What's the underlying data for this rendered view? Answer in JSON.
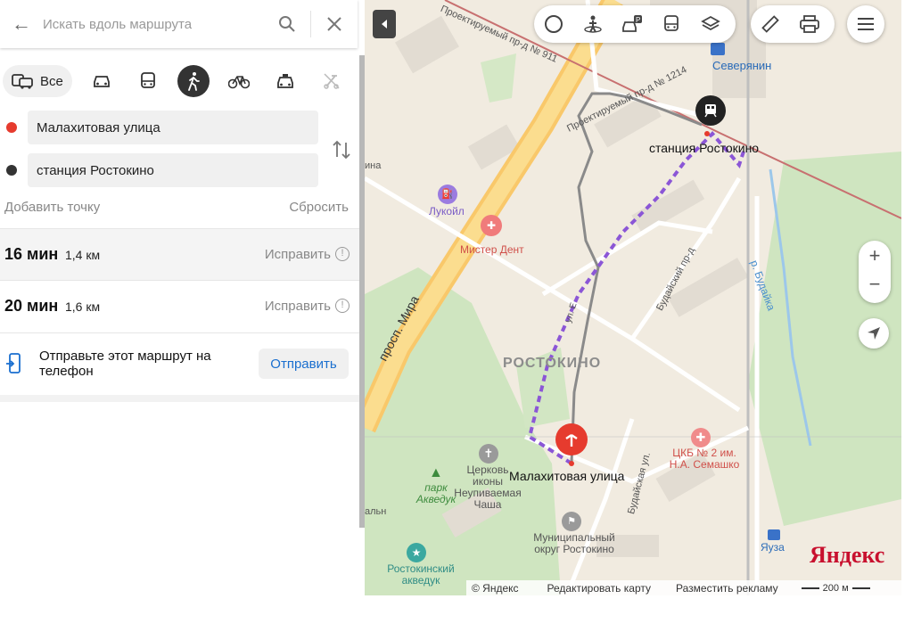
{
  "search": {
    "placeholder": "Искать вдоль маршрута"
  },
  "modes": {
    "all_label": "Все"
  },
  "points": {
    "from": "Малахитовая улица",
    "to": "станция Ростокино"
  },
  "actions": {
    "add_point": "Добавить точку",
    "reset": "Сбросить"
  },
  "routes": [
    {
      "time": "16 мин",
      "distance": "1,4 км",
      "fix": "Исправить"
    },
    {
      "time": "20 мин",
      "distance": "1,6 км",
      "fix": "Исправить"
    }
  ],
  "send": {
    "text": "Отправьте этот маршрут на телефон",
    "button": "Отправить"
  },
  "map": {
    "labels": {
      "station": "станция Ростокино",
      "street_start": "Малахитовая улица",
      "district": "РОСТОКИНО",
      "severyanin": "Северянин",
      "lukoil": "Лукойл",
      "mister_dent": "Мистер Дент",
      "prospekt": "просп. Мира",
      "proezd_911": "Проектируемый пр-д № 911",
      "proezd_1214": "Проектируемый пр-д № 1214",
      "budaysky_proezd": "Будайский пр-д",
      "budayskaya_ul": "Будайская ул.",
      "river": "р. Будайка",
      "church": "Церковь иконы Неупиваемая Чаша",
      "park": "парк Акведук",
      "municipal": "Муниципальный округ Ростокино",
      "hospital": "ЦКБ № 2 им. Н.А. Семашко",
      "aqueduct": "Ростокинский акведук",
      "yauza": "Яуза",
      "ul_e": "ул. Е",
      "ina": "ина",
      "alny": "альн"
    },
    "footer": {
      "copyright": "© Яндекс",
      "edit": "Редактировать карту",
      "ads": "Разместить рекламу",
      "scale": "200 м"
    },
    "logo": "Яндекс"
  },
  "colors": {
    "route": "#8b56d6",
    "start_marker": "#e63b2e",
    "accent": "#1a6fcf"
  }
}
